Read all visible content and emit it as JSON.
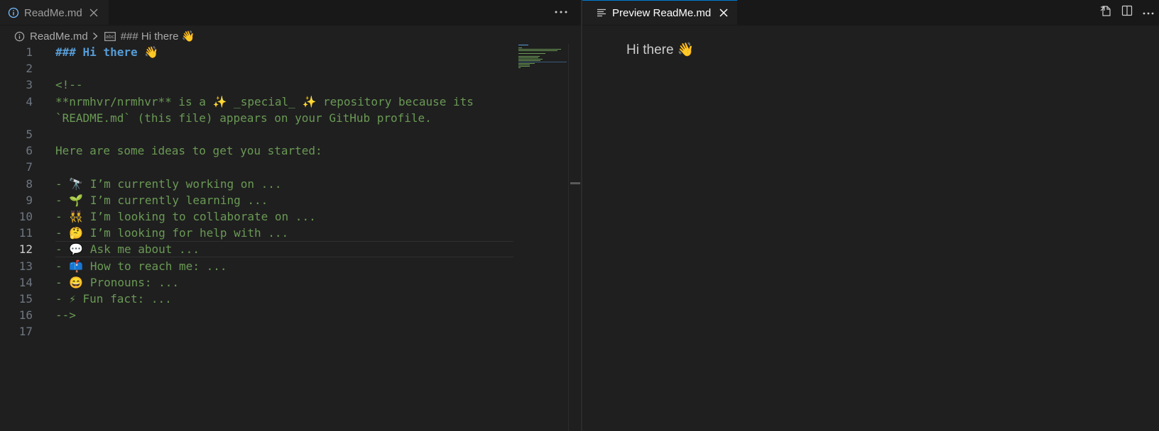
{
  "left_tab": {
    "label": "ReadMe.md",
    "icon": "info-icon"
  },
  "breadcrumb": {
    "file": "ReadMe.md",
    "symbol": "### Hi there 👋"
  },
  "editor": {
    "lines": [
      {
        "num": "1",
        "text": "### Hi there 👋"
      },
      {
        "num": "2",
        "text": ""
      },
      {
        "num": "3",
        "text": "<!--"
      },
      {
        "num": "4",
        "text": "**nrmhvr/nrmhvr** is a ✨ _special_ ✨ repository because its"
      },
      {
        "num": "",
        "text": "`README.md` (this file) appears on your GitHub profile."
      },
      {
        "num": "5",
        "text": ""
      },
      {
        "num": "6",
        "text": "Here are some ideas to get you started:"
      },
      {
        "num": "7",
        "text": ""
      },
      {
        "num": "8",
        "text": "- 🔭 I’m currently working on ..."
      },
      {
        "num": "9",
        "text": "- 🌱 I’m currently learning ..."
      },
      {
        "num": "10",
        "text": "- 👯 I’m looking to collaborate on ..."
      },
      {
        "num": "11",
        "text": "- 🤔 I’m looking for help with ..."
      },
      {
        "num": "12",
        "text": "- 💬 Ask me about ..."
      },
      {
        "num": "13",
        "text": "- 📫 How to reach me: ..."
      },
      {
        "num": "14",
        "text": "- 😄 Pronouns: ..."
      },
      {
        "num": "15",
        "text": "- ⚡ Fun fact: ..."
      },
      {
        "num": "16",
        "text": "-->"
      },
      {
        "num": "17",
        "text": ""
      }
    ],
    "active_line": "12"
  },
  "right_tab": {
    "label": "Preview ReadMe.md",
    "icon": "preview-icon"
  },
  "preview": {
    "heading": "Hi there 👋"
  },
  "colors": {
    "comment": "#6a9955",
    "heading": "#569cd6",
    "active_tab_border": "#0078d4"
  }
}
